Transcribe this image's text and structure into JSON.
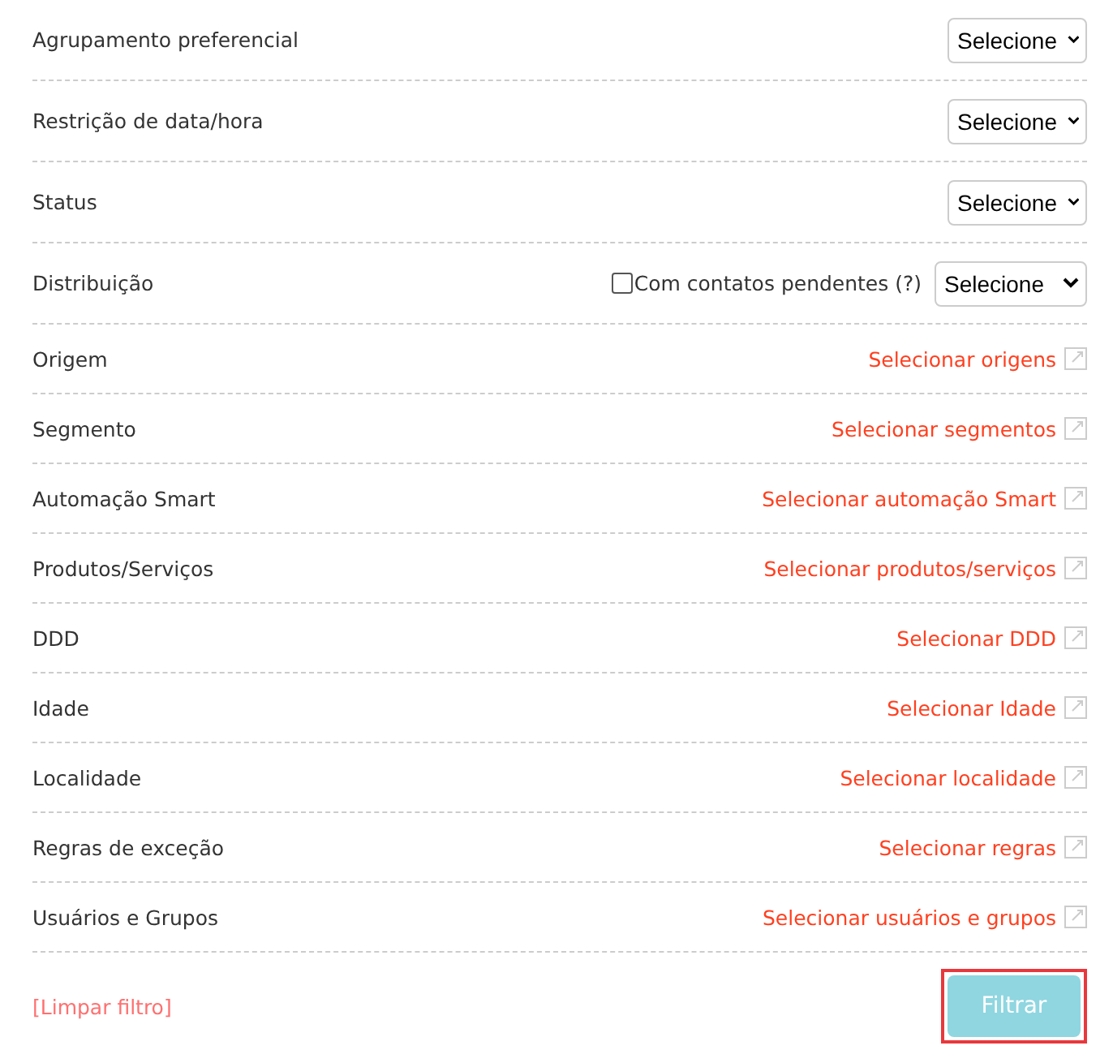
{
  "rows": [
    {
      "kind": "select",
      "label": "Agrupamento preferencial",
      "value": "Selecione"
    },
    {
      "kind": "select",
      "label": "Restrição de data/hora",
      "value": "Selecione"
    },
    {
      "kind": "select",
      "label": "Status",
      "value": "Selecione"
    },
    {
      "kind": "select_check",
      "label": "Distribuição",
      "check_label": "Com contatos pendentes (?)",
      "checked": false,
      "value": "Selecione"
    },
    {
      "kind": "link",
      "label": "Origem",
      "link": "Selecionar origens"
    },
    {
      "kind": "link",
      "label": "Segmento",
      "link": "Selecionar segmentos"
    },
    {
      "kind": "link",
      "label": "Automação Smart",
      "link": "Selecionar automação Smart"
    },
    {
      "kind": "link",
      "label": "Produtos/Serviços",
      "link": "Selecionar produtos/serviços"
    },
    {
      "kind": "link",
      "label": "DDD",
      "link": "Selecionar DDD"
    },
    {
      "kind": "link",
      "label": "Idade",
      "link": "Selecionar Idade"
    },
    {
      "kind": "link",
      "label": "Localidade",
      "link": "Selecionar localidade"
    },
    {
      "kind": "link",
      "label": "Regras de exceção",
      "link": "Selecionar regras"
    },
    {
      "kind": "link",
      "label": "Usuários e Grupos",
      "link": "Selecionar usuários e grupos"
    }
  ],
  "clear_link": "[Limpar filtro]",
  "filter_button": {
    "label": "Filtrar",
    "highlighted": true
  }
}
